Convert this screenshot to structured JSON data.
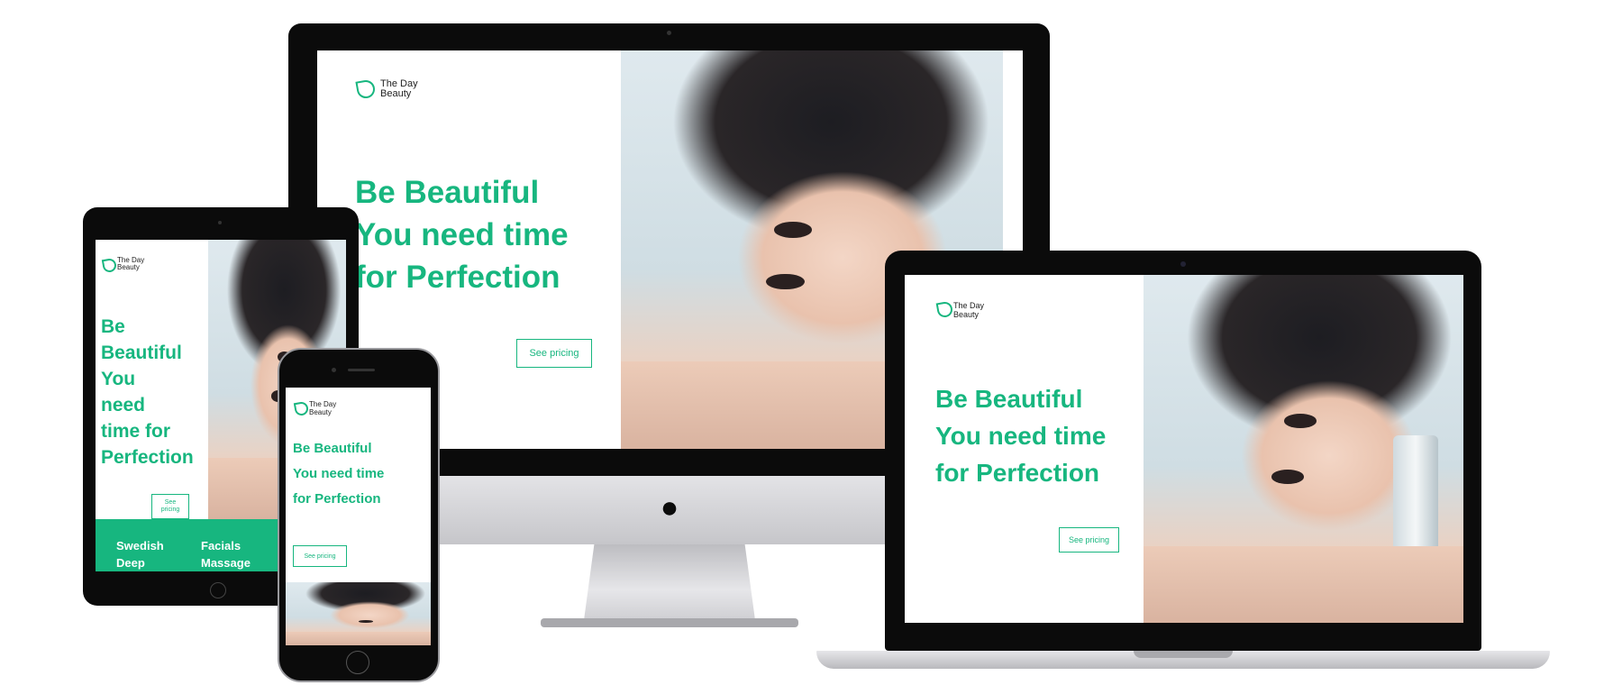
{
  "brand": {
    "line1": "The Day",
    "line2": "Beauty"
  },
  "hero": {
    "line1": "Be Beautiful",
    "line2": "You need time",
    "line3": "for Perfection",
    "cta": "See pricing"
  },
  "tablet_hero": {
    "words": [
      "Be",
      "Beautiful",
      "You",
      "need",
      "time for",
      "Perfection"
    ],
    "cta_line1": "See",
    "cta_line2": "pricing"
  },
  "services": {
    "col1": [
      "Swedish",
      "Deep"
    ],
    "col2": [
      "Facials",
      "Massage"
    ]
  },
  "colors": {
    "accent": "#17b67f",
    "device": "#0b0b0b",
    "silver": "#c9c9cc"
  },
  "icons": {
    "apple_logo": "apple-logo-icon"
  }
}
